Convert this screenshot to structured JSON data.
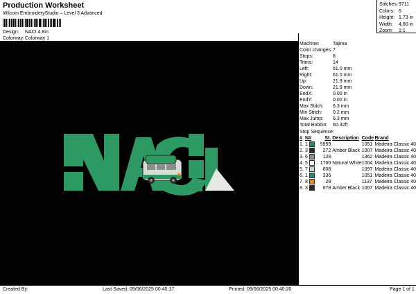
{
  "header": {
    "title": "Production Worksheet",
    "subtitle": "Wilcom EmbroideryStudio – Level 3 Advanced",
    "design_label": "Design:",
    "design_value": "NACI 4.8in",
    "colorway_label": "Colorway:",
    "colorway_value": "Colorway 1"
  },
  "summary": [
    {
      "label": "Stitches:",
      "value": "9711"
    },
    {
      "label": "Colors:",
      "value": "6"
    },
    {
      "label": "Height:",
      "value": "1.73 in"
    },
    {
      "label": "Width:",
      "value": "4.80 in"
    },
    {
      "label": "Zoom:",
      "value": "1:1"
    }
  ],
  "machine_info": [
    {
      "label": "Machine:",
      "value": "Tajima"
    },
    {
      "label": "Color changes:",
      "value": "7"
    },
    {
      "label": "Stops:",
      "value": "8"
    },
    {
      "label": "Trims:",
      "value": "14"
    },
    {
      "label": "Left:",
      "value": "61.0 mm"
    },
    {
      "label": "Right:",
      "value": "61.0 mm"
    },
    {
      "label": "Up:",
      "value": "21.9 mm"
    },
    {
      "label": "Down:",
      "value": "21.9 mm"
    },
    {
      "label": "EndX:",
      "value": "0.00 in"
    },
    {
      "label": "EndY:",
      "value": "0.00 in"
    },
    {
      "label": "Max Stitch:",
      "value": "6.3 mm"
    },
    {
      "label": "Min Stitch:",
      "value": "0.2 mm"
    },
    {
      "label": "Max Jump:",
      "value": "6.3 mm"
    },
    {
      "label": "Total Bobbin:",
      "value": "60.32ft"
    }
  ],
  "stop_sequence": {
    "title": "Stop Sequence:",
    "headers": [
      "#",
      "N#",
      "St.",
      "Description",
      "Code",
      "Brand"
    ],
    "rows": [
      {
        "n": "1.",
        "needle": "1",
        "color": "#1f8f5f",
        "st": "5959",
        "desc": "",
        "code": "1051",
        "brand": "Madeira Classic 40"
      },
      {
        "n": "2.",
        "needle": "3",
        "color": "#2a2a2a",
        "st": "272",
        "desc": "Amber Black",
        "code": "1007",
        "brand": "Madeira Classic 40"
      },
      {
        "n": "3.",
        "needle": "6",
        "color": "#8a8f8a",
        "st": "128",
        "desc": "",
        "code": "1362",
        "brand": "Madeira Classic 40"
      },
      {
        "n": "4.",
        "needle": "5",
        "color": "#f4f4f0",
        "st": "1700",
        "desc": "Natural White",
        "code": "1004",
        "brand": "Madeira Classic 40"
      },
      {
        "n": "5.",
        "needle": "7",
        "color": "#c9d2c9",
        "st": "608",
        "desc": "",
        "code": "1097",
        "brand": "Madeira Classic 40"
      },
      {
        "n": "6.",
        "needle": "1",
        "color": "#1f8f5f",
        "st": "336",
        "desc": "",
        "code": "1051",
        "brand": "Madeira Classic 40"
      },
      {
        "n": "7.",
        "needle": "8",
        "color": "#e08a1e",
        "st": "28",
        "desc": "",
        "code": "1137",
        "brand": "Madeira Classic 40"
      },
      {
        "n": "8.",
        "needle": "3",
        "color": "#2a2a2a",
        "st": "678",
        "desc": "Amber Black",
        "code": "1007",
        "brand": "Madeira Classic 40"
      }
    ]
  },
  "logo": {
    "letters": "NACiL",
    "green": "#2e9a63",
    "white": "#e6e8e4"
  },
  "footer": {
    "created_by": "Created By:",
    "last_saved": "Last Saved: 09/06/2025 00:40:17",
    "printed": "Printed: 09/06/2025 00:40:20",
    "page": "Page 1 of 1"
  }
}
